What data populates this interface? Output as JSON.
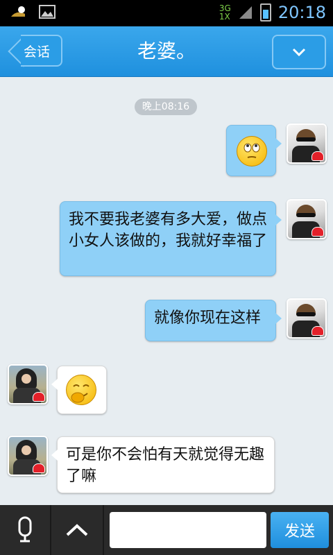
{
  "status_bar": {
    "time": "20:18",
    "network_top": "3G",
    "network_bottom": "1X"
  },
  "header": {
    "back_label": "会话",
    "title": "老婆。",
    "menu_icon": "chevron-down-icon"
  },
  "chat": {
    "timestamp": "晚上08:16",
    "messages": [
      {
        "sender": "me",
        "type": "emoji",
        "icon": "rolling-eyes-emoji-icon"
      },
      {
        "sender": "me",
        "type": "text",
        "text": "我不要我老婆有多大爱，做点小女人该做的，我就好幸福了"
      },
      {
        "sender": "me",
        "type": "text",
        "text": "就像你现在这样"
      },
      {
        "sender": "other",
        "type": "emoji",
        "icon": "shy-smile-emoji-icon"
      },
      {
        "sender": "other",
        "type": "text",
        "text": "可是你不会怕有天就觉得无趣了嘛"
      }
    ]
  },
  "input_bar": {
    "message_value": "",
    "message_placeholder": "",
    "send_label": "发送"
  },
  "colors": {
    "header": "#1f90de",
    "out_bubble": "#8fd0f7",
    "in_bubble": "#ffffff",
    "send_button": "#2a9ae6"
  }
}
